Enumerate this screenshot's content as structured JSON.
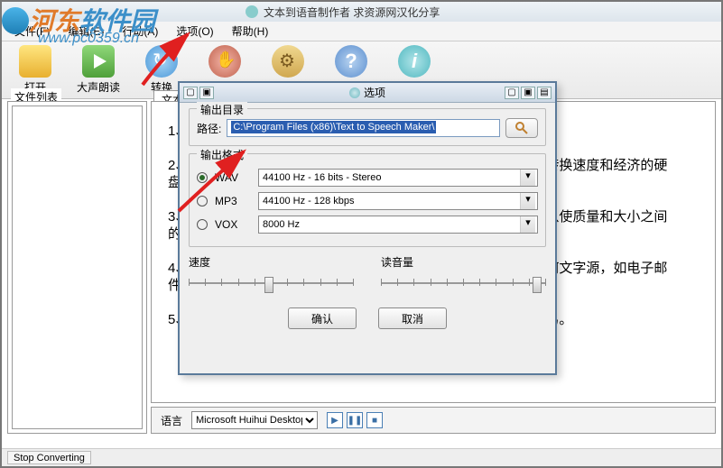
{
  "watermark": {
    "brand": "河东软件园",
    "url": "www.pc0359.cn"
  },
  "titlebar": {
    "text": "文本到语音制作者 求资源网汉化分享"
  },
  "menu": {
    "file": "文件(F)",
    "edit": "编辑(E)",
    "action": "行动(A)",
    "options": "选项(O)",
    "help": "帮助(H)"
  },
  "toolbar": {
    "open": "打开",
    "read": "大声朗读",
    "convert": "转换",
    "stop": "停",
    "settings": "选项",
    "help": "帮助",
    "about": "关于"
  },
  "left_panel": {
    "title": "文件列表"
  },
  "tabs": {
    "text": "文本"
  },
  "document": {
    "line1": "1、支持",
    "line2_a": "2、",
    "line2_b": "高转换速度和经济的硬",
    "line2_c": "盘空间",
    "line3_a": "3、",
    "line3_b": "可以使质量和大小之间",
    "line3_c": "的选择",
    "line4_a": "4、",
    "line4_b": "任何文字源，如电子邮",
    "line4_c": "件，网",
    "line5_a": "5、",
    "line5_b": "容易。"
  },
  "lang_bar": {
    "label": "语言",
    "value": "Microsoft Huihui Desktop"
  },
  "status": {
    "text": "Stop Converting"
  },
  "dialog": {
    "title": "选项",
    "group_output": "输出目录",
    "path_label": "路径:",
    "path_value": "C:\\Program Files (x86)\\Text to Speech Maker\\",
    "group_format": "输出格式",
    "wav_label": "WAV",
    "wav_value": "44100 Hz - 16 bits  - Stereo",
    "mp3_label": "MP3",
    "mp3_value": "44100 Hz - 128 kbps",
    "vox_label": "VOX",
    "vox_value": "8000 Hz",
    "speed_label": "速度",
    "volume_label": "读音量",
    "ok": "确认",
    "cancel": "取消"
  }
}
